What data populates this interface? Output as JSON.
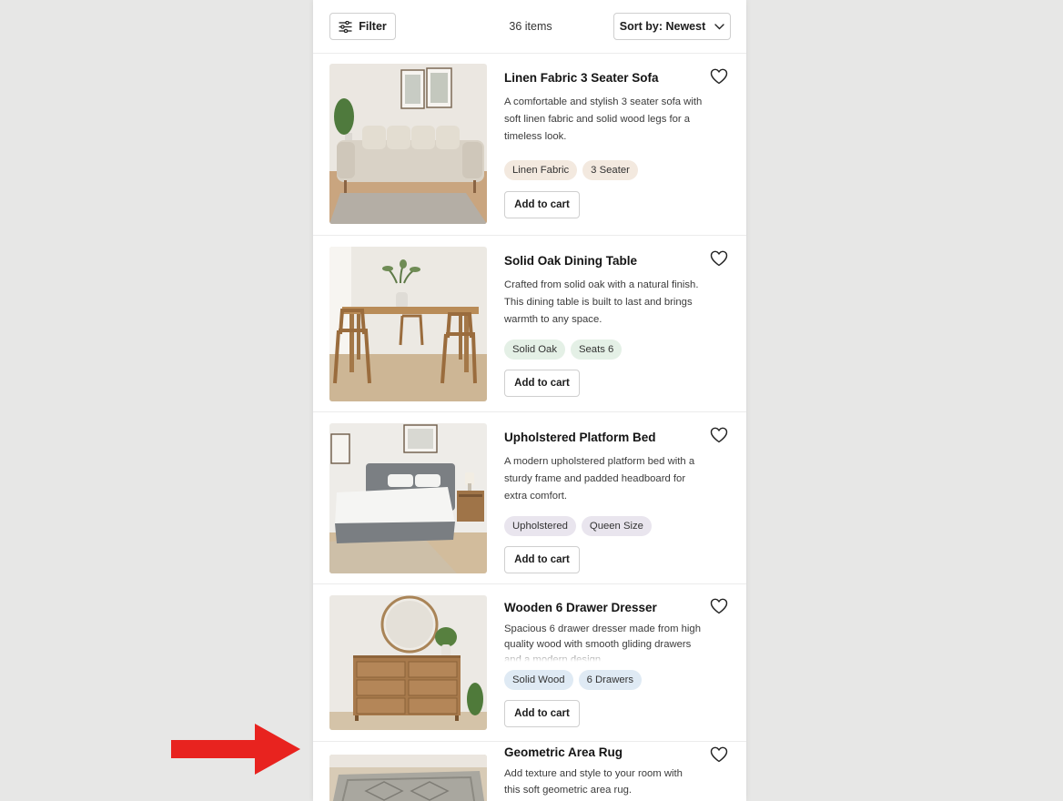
{
  "toolbar": {
    "filter_label": "Filter",
    "filter_icon": "sliders-icon",
    "count_text": "36 items",
    "sort_label": "Sort by: Newest",
    "sort_icon": "chevron-down-icon"
  },
  "colors": {
    "page_background": "#e7e7e6",
    "panel_background": "#ffffff",
    "arrow": "#e8231f"
  },
  "products": [
    {
      "title": "Linen Fabric 3 Seater Sofa",
      "description": "A comfortable and stylish 3 seater sofa with soft linen fabric and solid wood legs for a timeless look.",
      "tags": [
        "Linen Fabric",
        "3 Seater"
      ],
      "tag_color": "#f3e9df",
      "cart_label": "Add to cart",
      "image": "sofa-photo"
    },
    {
      "title": "Solid Oak Dining Table",
      "description": "Crafted from solid oak with a natural finish. This dining table is built to last and brings warmth to any space.",
      "tags": [
        "Solid Oak",
        "Seats 6"
      ],
      "tag_color": "#e4f0e6",
      "cart_label": "Add to cart",
      "image": "dining-table-photo"
    },
    {
      "title": "Upholstered Platform Bed",
      "description": "A modern upholstered platform bed with a sturdy frame and padded headboard for extra comfort.",
      "tags": [
        "Upholstered",
        "Queen Size"
      ],
      "tag_color": "#e9e5ee",
      "cart_label": "Add to cart",
      "image": "bed-photo"
    },
    {
      "title": "Wooden 6 Drawer Dresser",
      "description": "Spacious 6 drawer dresser made from high quality wood with smooth gliding drawers and a modern design.",
      "tags": [
        "Solid Wood",
        "6 Drawers"
      ],
      "tag_color": "#dfeaf4",
      "cart_label": "Add to cart",
      "image": "dresser-photo"
    },
    {
      "title": "Geometric Area Rug",
      "description": "Add texture and style to your room with this soft geometric area rug.",
      "image": "rug-photo"
    }
  ]
}
